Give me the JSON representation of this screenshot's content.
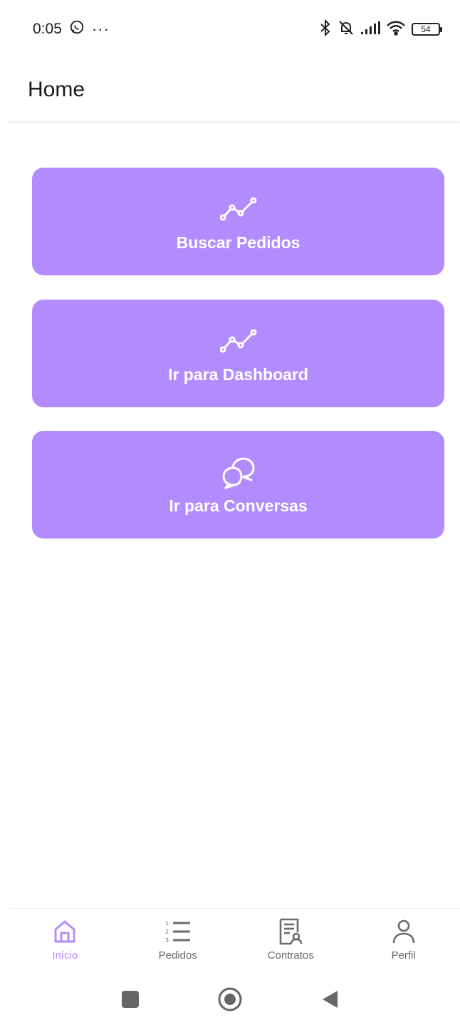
{
  "status_bar": {
    "time": "0:05",
    "battery": "54",
    "icons": [
      "whatsapp-icon",
      "more-dots-icon",
      "bluetooth-icon",
      "bell-off-icon",
      "signal-icon",
      "wifi-icon",
      "battery-icon"
    ]
  },
  "header": {
    "title": "Home"
  },
  "cards": [
    {
      "label": "Buscar Pedidos",
      "icon": "chart-line-icon"
    },
    {
      "label": "Ir para Dashboard",
      "icon": "chart-line-icon"
    },
    {
      "label": "Ir para Conversas",
      "icon": "chat-bubbles-icon"
    }
  ],
  "bottom_nav": {
    "items": [
      {
        "label": "Início",
        "icon": "home-icon",
        "active": true
      },
      {
        "label": "Pedidos",
        "icon": "numbered-list-icon",
        "active": false
      },
      {
        "label": "Contratos",
        "icon": "contract-icon",
        "active": false
      },
      {
        "label": "Perfil",
        "icon": "user-icon",
        "active": false
      }
    ]
  },
  "colors": {
    "accent": "#b28cff",
    "card_text": "#ffffff",
    "nav_inactive": "#6b6b6b"
  }
}
